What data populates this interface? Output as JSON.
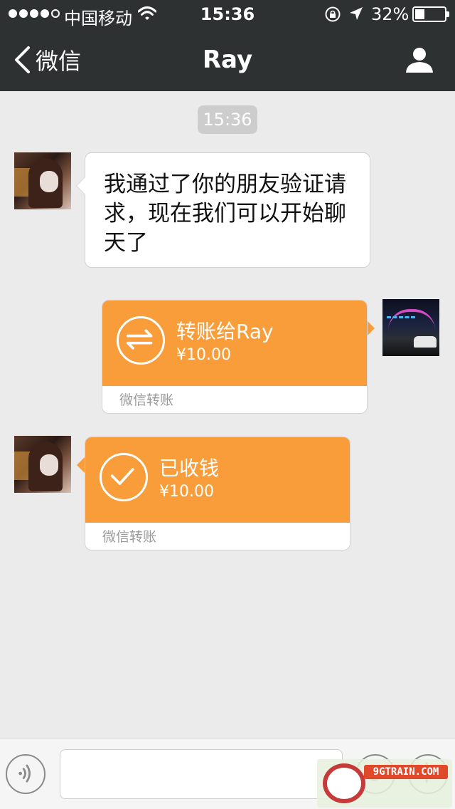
{
  "status_bar": {
    "carrier": "中国移动",
    "time": "15:36",
    "battery_percent": "32%",
    "battery_level": 0.32,
    "signal_filled": 4,
    "signal_total": 5
  },
  "nav": {
    "back_label": "微信",
    "title": "Ray",
    "back_icon": "chevron-left-icon",
    "profile_icon": "person-icon"
  },
  "chat": {
    "timestamp": "15:36",
    "messages": [
      {
        "from": "Ray",
        "type": "text",
        "text": "我通过了你的朋友验证请求，现在我们可以开始聊天了"
      },
      {
        "from": "me",
        "type": "transfer",
        "title": "转账给Ray",
        "amount": "¥10.00",
        "footer": "微信转账",
        "icon": "transfer-arrows-icon"
      },
      {
        "from": "Ray",
        "type": "transfer",
        "title": "已收钱",
        "amount": "¥10.00",
        "footer": "微信转账",
        "icon": "checkmark-icon"
      }
    ]
  },
  "input_bar": {
    "placeholder": "",
    "voice_icon": "voice-icon",
    "emoji_icon": "emoji-icon",
    "plus_icon": "plus-icon"
  },
  "watermark": {
    "text": "9GTRAIN.COM"
  },
  "colors": {
    "topbar": "#2e3132",
    "background": "#ebebeb",
    "transfer_orange": "#f99d3a",
    "timestamp_bg": "#cdcdcd"
  }
}
